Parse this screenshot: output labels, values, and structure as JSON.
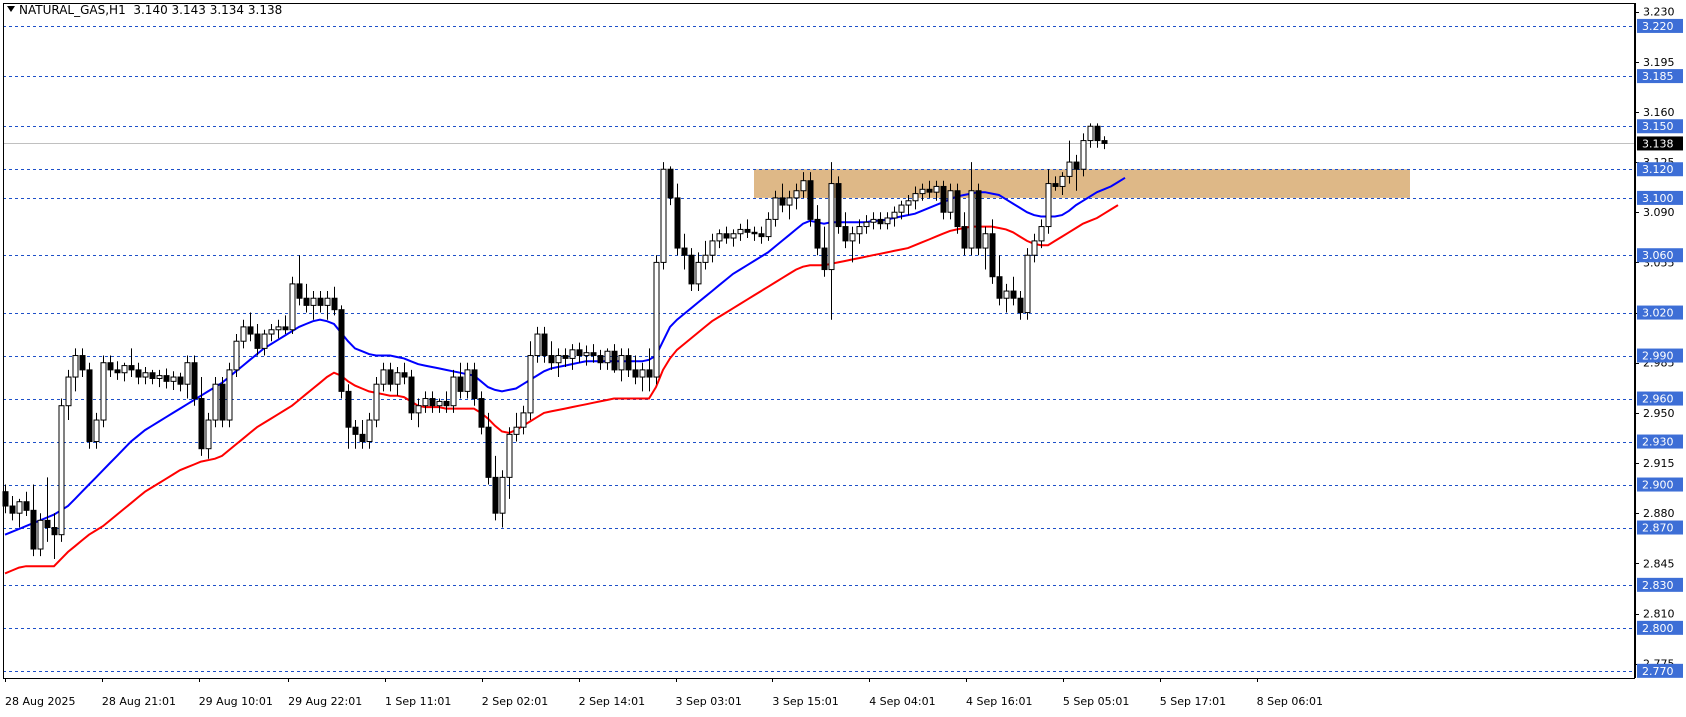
{
  "header": {
    "symbol": "NATURAL_GAS,H1",
    "ohlc": "3.140 3.143 3.134 3.138"
  },
  "chart_data": {
    "type": "candlestick",
    "title": "NATURAL_GAS,H1",
    "ylim": [
      2.765,
      3.236
    ],
    "price_axis_ticks": [
      "3.230",
      "3.195",
      "3.160",
      "3.125",
      "3.090",
      "3.055",
      "3.020",
      "2.985",
      "2.950",
      "2.915",
      "2.880",
      "2.845",
      "2.810",
      "2.775"
    ],
    "time_axis_labels": [
      "28 Aug 2025",
      "28 Aug 21:01",
      "29 Aug 10:01",
      "29 Aug 22:01",
      "1 Sep 11:01",
      "2 Sep 02:01",
      "2 Sep 14:01",
      "3 Sep 03:01",
      "3 Sep 15:01",
      "4 Sep 04:01",
      "4 Sep 16:01",
      "5 Sep 05:01",
      "5 Sep 17:01",
      "8 Sep 06:01"
    ],
    "levels": [
      {
        "label": "3.220",
        "value": 3.22
      },
      {
        "label": "3.185",
        "value": 3.185
      },
      {
        "label": "3.150",
        "value": 3.15
      },
      {
        "label": "3.120",
        "value": 3.12
      },
      {
        "label": "3.100",
        "value": 3.1
      },
      {
        "label": "3.060",
        "value": 3.06
      },
      {
        "label": "3.020",
        "value": 3.02
      },
      {
        "label": "2.990",
        "value": 2.99
      },
      {
        "label": "2.960",
        "value": 2.96
      },
      {
        "label": "2.930",
        "value": 2.93
      },
      {
        "label": "2.900",
        "value": 2.9
      },
      {
        "label": "2.870",
        "value": 2.87
      },
      {
        "label": "2.830",
        "value": 2.83
      },
      {
        "label": "2.800",
        "value": 2.8
      },
      {
        "label": "2.770",
        "value": 2.77
      }
    ],
    "current_price": {
      "label": "3.138",
      "value": 3.138
    },
    "zone": {
      "low": 3.1,
      "high": 3.12,
      "color": "#deb887"
    },
    "candles": [
      [
        2.895,
        2.9,
        2.88,
        2.885
      ],
      [
        2.885,
        2.892,
        2.875,
        2.88
      ],
      [
        2.88,
        2.89,
        2.87,
        2.888
      ],
      [
        2.888,
        2.895,
        2.878,
        2.882
      ],
      [
        2.882,
        2.9,
        2.85,
        2.855
      ],
      [
        2.855,
        2.88,
        2.85,
        2.875
      ],
      [
        2.875,
        2.905,
        2.86,
        2.87
      ],
      [
        2.87,
        2.88,
        2.848,
        2.865
      ],
      [
        2.865,
        2.96,
        2.86,
        2.955
      ],
      [
        2.955,
        2.98,
        2.945,
        2.975
      ],
      [
        2.975,
        2.995,
        2.965,
        2.99
      ],
      [
        2.99,
        2.995,
        2.975,
        2.98
      ],
      [
        2.98,
        2.985,
        2.925,
        2.93
      ],
      [
        2.93,
        2.95,
        2.925,
        2.945
      ],
      [
        2.945,
        2.99,
        2.94,
        2.985
      ],
      [
        2.985,
        2.99,
        2.975,
        2.98
      ],
      [
        2.98,
        2.986,
        2.973,
        2.978
      ],
      [
        2.978,
        2.985,
        2.972,
        2.983
      ],
      [
        2.983,
        2.995,
        2.975,
        2.98
      ],
      [
        2.98,
        2.985,
        2.97,
        2.975
      ],
      [
        2.975,
        2.982,
        2.97,
        2.978
      ],
      [
        2.978,
        2.98,
        2.97,
        2.974
      ],
      [
        2.974,
        2.98,
        2.968,
        2.976
      ],
      [
        2.976,
        2.981,
        2.967,
        2.972
      ],
      [
        2.972,
        2.979,
        2.966,
        2.975
      ],
      [
        2.975,
        2.978,
        2.965,
        2.97
      ],
      [
        2.97,
        2.99,
        2.96,
        2.985
      ],
      [
        2.985,
        2.99,
        2.955,
        2.96
      ],
      [
        2.96,
        2.975,
        2.92,
        2.925
      ],
      [
        2.925,
        2.95,
        2.918,
        2.945
      ],
      [
        2.945,
        2.975,
        2.94,
        2.97
      ],
      [
        2.97,
        2.975,
        2.94,
        2.945
      ],
      [
        2.945,
        2.985,
        2.94,
        2.98
      ],
      [
        2.98,
        3.005,
        2.975,
        3.0
      ],
      [
        3.0,
        3.015,
        2.995,
        3.01
      ],
      [
        3.01,
        3.02,
        3.0,
        3.005
      ],
      [
        3.005,
        3.012,
        2.99,
        2.995
      ],
      [
        2.995,
        3.008,
        2.99,
        3.005
      ],
      [
        3.005,
        3.012,
        3.0,
        3.008
      ],
      [
        3.008,
        3.015,
        3.002,
        3.01
      ],
      [
        3.01,
        3.018,
        3.005,
        3.008
      ],
      [
        3.008,
        3.045,
        3.005,
        3.04
      ],
      [
        3.04,
        3.06,
        3.025,
        3.03
      ],
      [
        3.03,
        3.04,
        3.02,
        3.025
      ],
      [
        3.025,
        3.035,
        3.015,
        3.03
      ],
      [
        3.03,
        3.035,
        3.02,
        3.025
      ],
      [
        3.025,
        3.035,
        3.015,
        3.03
      ],
      [
        3.03,
        3.038,
        3.018,
        3.022
      ],
      [
        3.022,
        3.025,
        2.96,
        2.965
      ],
      [
        2.965,
        2.97,
        2.925,
        2.94
      ],
      [
        2.94,
        2.945,
        2.925,
        2.935
      ],
      [
        2.935,
        2.945,
        2.925,
        2.93
      ],
      [
        2.93,
        2.95,
        2.925,
        2.945
      ],
      [
        2.945,
        2.975,
        2.94,
        2.97
      ],
      [
        2.97,
        2.985,
        2.965,
        2.98
      ],
      [
        2.98,
        2.985,
        2.965,
        2.97
      ],
      [
        2.97,
        2.982,
        2.962,
        2.978
      ],
      [
        2.978,
        2.985,
        2.97,
        2.975
      ],
      [
        2.975,
        2.98,
        2.945,
        2.95
      ],
      [
        2.95,
        2.96,
        2.94,
        2.955
      ],
      [
        2.955,
        2.965,
        2.95,
        2.96
      ],
      [
        2.96,
        2.965,
        2.95,
        2.955
      ],
      [
        2.955,
        2.96,
        2.95,
        2.958
      ],
      [
        2.958,
        2.965,
        2.95,
        2.955
      ],
      [
        2.955,
        2.98,
        2.95,
        2.975
      ],
      [
        2.975,
        2.985,
        2.96,
        2.965
      ],
      [
        2.965,
        2.985,
        2.96,
        2.98
      ],
      [
        2.98,
        2.985,
        2.955,
        2.96
      ],
      [
        2.96,
        2.965,
        2.935,
        2.94
      ],
      [
        2.94,
        2.95,
        2.9,
        2.905
      ],
      [
        2.905,
        2.92,
        2.875,
        2.88
      ],
      [
        2.88,
        2.91,
        2.87,
        2.905
      ],
      [
        2.905,
        2.94,
        2.89,
        2.935
      ],
      [
        2.935,
        2.95,
        2.93,
        2.94
      ],
      [
        2.94,
        2.955,
        2.935,
        2.95
      ],
      [
        2.95,
        3.0,
        2.945,
        2.99
      ],
      [
        2.99,
        3.01,
        2.985,
        3.005
      ],
      [
        3.005,
        3.01,
        2.985,
        2.99
      ],
      [
        2.99,
        3.0,
        2.98,
        2.985
      ],
      [
        2.985,
        2.995,
        2.975,
        2.99
      ],
      [
        2.99,
        2.995,
        2.982,
        2.988
      ],
      [
        2.988,
        2.998,
        2.98,
        2.994
      ],
      [
        2.994,
        2.999,
        2.985,
        2.99
      ],
      [
        2.99,
        2.997,
        2.983,
        2.992
      ],
      [
        2.992,
        2.998,
        2.985,
        2.99
      ],
      [
        2.99,
        2.994,
        2.98,
        2.985
      ],
      [
        2.985,
        2.995,
        2.98,
        2.993
      ],
      [
        2.993,
        2.998,
        2.978,
        2.98
      ],
      [
        2.98,
        2.995,
        2.972,
        2.99
      ],
      [
        2.99,
        2.995,
        2.975,
        2.98
      ],
      [
        2.98,
        2.99,
        2.97,
        2.975
      ],
      [
        2.975,
        2.985,
        2.965,
        2.98
      ],
      [
        2.98,
        2.995,
        2.965,
        2.975
      ],
      [
        2.975,
        3.06,
        2.97,
        3.055
      ],
      [
        3.055,
        3.125,
        3.05,
        3.12
      ],
      [
        3.12,
        3.122,
        3.095,
        3.1
      ],
      [
        3.1,
        3.11,
        3.06,
        3.065
      ],
      [
        3.065,
        3.075,
        3.05,
        3.06
      ],
      [
        3.06,
        3.065,
        3.035,
        3.04
      ],
      [
        3.04,
        3.062,
        3.035,
        3.055
      ],
      [
        3.055,
        3.07,
        3.05,
        3.06
      ],
      [
        3.06,
        3.075,
        3.055,
        3.07
      ],
      [
        3.07,
        3.078,
        3.065,
        3.075
      ],
      [
        3.075,
        3.08,
        3.068,
        3.072
      ],
      [
        3.072,
        3.078,
        3.066,
        3.075
      ],
      [
        3.075,
        3.082,
        3.07,
        3.078
      ],
      [
        3.078,
        3.085,
        3.072,
        3.076
      ],
      [
        3.076,
        3.08,
        3.07,
        3.075
      ],
      [
        3.075,
        3.08,
        3.068,
        3.073
      ],
      [
        3.073,
        3.09,
        3.07,
        3.085
      ],
      [
        3.085,
        3.105,
        3.08,
        3.1
      ],
      [
        3.1,
        3.11,
        3.09,
        3.095
      ],
      [
        3.095,
        3.105,
        3.085,
        3.1
      ],
      [
        3.1,
        3.11,
        3.092,
        3.105
      ],
      [
        3.105,
        3.118,
        3.1,
        3.112
      ],
      [
        3.112,
        3.118,
        3.08,
        3.085
      ],
      [
        3.085,
        3.095,
        3.06,
        3.065
      ],
      [
        3.065,
        3.08,
        3.045,
        3.05
      ],
      [
        3.05,
        3.125,
        3.015,
        3.11
      ],
      [
        3.11,
        3.115,
        3.075,
        3.08
      ],
      [
        3.08,
        3.09,
        3.065,
        3.07
      ],
      [
        3.07,
        3.08,
        3.055,
        3.075
      ],
      [
        3.075,
        3.085,
        3.068,
        3.08
      ],
      [
        3.08,
        3.088,
        3.075,
        3.083
      ],
      [
        3.083,
        3.09,
        3.078,
        3.085
      ],
      [
        3.085,
        3.09,
        3.078,
        3.082
      ],
      [
        3.082,
        3.09,
        3.078,
        3.086
      ],
      [
        3.086,
        3.094,
        3.08,
        3.09
      ],
      [
        3.09,
        3.098,
        3.085,
        3.095
      ],
      [
        3.095,
        3.102,
        3.088,
        3.098
      ],
      [
        3.098,
        3.108,
        3.092,
        3.103
      ],
      [
        3.103,
        3.11,
        3.098,
        3.106
      ],
      [
        3.106,
        3.112,
        3.1,
        3.104
      ],
      [
        3.104,
        3.112,
        3.098,
        3.108
      ],
      [
        3.108,
        3.112,
        3.085,
        3.09
      ],
      [
        3.09,
        3.11,
        3.085,
        3.105
      ],
      [
        3.105,
        3.11,
        3.075,
        3.08
      ],
      [
        3.08,
        3.09,
        3.06,
        3.065
      ],
      [
        3.065,
        3.125,
        3.06,
        3.105
      ],
      [
        3.105,
        3.11,
        3.06,
        3.065
      ],
      [
        3.065,
        3.08,
        3.05,
        3.075
      ],
      [
        3.075,
        3.085,
        3.04,
        3.045
      ],
      [
        3.045,
        3.06,
        3.025,
        3.03
      ],
      [
        3.03,
        3.04,
        3.02,
        3.035
      ],
      [
        3.035,
        3.045,
        3.025,
        3.03
      ],
      [
        3.03,
        3.035,
        3.015,
        3.02
      ],
      [
        3.02,
        3.065,
        3.015,
        3.06
      ],
      [
        3.06,
        3.075,
        3.055,
        3.07
      ],
      [
        3.07,
        3.085,
        3.065,
        3.08
      ],
      [
        3.08,
        3.12,
        3.075,
        3.11
      ],
      [
        3.11,
        3.115,
        3.105,
        3.108
      ],
      [
        3.108,
        3.118,
        3.102,
        3.115
      ],
      [
        3.115,
        3.14,
        3.11,
        3.125
      ],
      [
        3.125,
        3.13,
        3.105,
        3.12
      ],
      [
        3.12,
        3.145,
        3.115,
        3.14
      ],
      [
        3.14,
        3.152,
        3.135,
        3.15
      ],
      [
        3.15,
        3.152,
        3.135,
        3.14
      ],
      [
        3.14,
        3.143,
        3.134,
        3.138
      ]
    ],
    "series": [
      {
        "color": "#0000ff",
        "values": [
          2.865,
          2.867,
          2.869,
          2.871,
          2.873,
          2.875,
          2.877,
          2.879,
          2.882,
          2.885,
          2.89,
          2.895,
          2.9,
          2.905,
          2.91,
          2.915,
          2.92,
          2.925,
          2.93,
          2.934,
          2.938,
          2.941,
          2.944,
          2.947,
          2.95,
          2.953,
          2.956,
          2.959,
          2.962,
          2.965,
          2.968,
          2.971,
          2.975,
          2.979,
          2.983,
          2.987,
          2.991,
          2.995,
          2.998,
          3.001,
          3.004,
          3.007,
          3.01,
          3.012,
          3.014,
          3.015,
          3.014,
          3.012,
          3.006,
          3.0,
          2.995,
          2.993,
          2.991,
          2.99,
          2.99,
          2.99,
          2.989,
          2.988,
          2.986,
          2.984,
          2.983,
          2.982,
          2.981,
          2.98,
          2.979,
          2.978,
          2.977,
          2.976,
          2.972,
          2.968,
          2.966,
          2.965,
          2.966,
          2.967,
          2.97,
          2.973,
          2.976,
          2.979,
          2.981,
          2.982,
          2.983,
          2.984,
          2.985,
          2.986,
          2.986,
          2.986,
          2.986,
          2.986,
          2.986,
          2.986,
          2.986,
          2.986,
          2.987,
          2.99,
          3.0,
          3.01,
          3.015,
          3.019,
          3.023,
          3.027,
          3.031,
          3.035,
          3.039,
          3.043,
          3.047,
          3.05,
          3.053,
          3.056,
          3.059,
          3.062,
          3.066,
          3.07,
          3.074,
          3.078,
          3.082,
          3.084,
          3.083,
          3.082,
          3.083,
          3.083,
          3.083,
          3.083,
          3.083,
          3.083,
          3.084,
          3.084,
          3.085,
          3.086,
          3.087,
          3.088,
          3.089,
          3.091,
          3.093,
          3.095,
          3.097,
          3.099,
          3.101,
          3.102,
          3.103,
          3.104,
          3.104,
          3.103,
          3.102,
          3.099,
          3.096,
          3.093,
          3.09,
          3.088,
          3.087,
          3.087,
          3.087,
          3.088,
          3.091,
          3.095,
          3.098,
          3.101,
          3.104,
          3.106,
          3.108,
          3.111,
          3.114
        ]
      },
      {
        "color": "#ff0000",
        "values": [
          2.838,
          2.84,
          2.842,
          2.843,
          2.843,
          2.843,
          2.843,
          2.843,
          2.848,
          2.853,
          2.857,
          2.861,
          2.865,
          2.868,
          2.871,
          2.875,
          2.879,
          2.883,
          2.887,
          2.891,
          2.895,
          2.898,
          2.901,
          2.904,
          2.907,
          2.91,
          2.912,
          2.914,
          2.916,
          2.917,
          2.918,
          2.92,
          2.924,
          2.928,
          2.932,
          2.936,
          2.94,
          2.943,
          2.946,
          2.949,
          2.952,
          2.955,
          2.959,
          2.963,
          2.967,
          2.971,
          2.975,
          2.978,
          2.976,
          2.972,
          2.969,
          2.967,
          2.965,
          2.964,
          2.963,
          2.962,
          2.962,
          2.961,
          2.958,
          2.955,
          2.954,
          2.954,
          2.954,
          2.953,
          2.953,
          2.953,
          2.953,
          2.953,
          2.95,
          2.946,
          2.941,
          2.937,
          2.936,
          2.938,
          2.941,
          2.944,
          2.947,
          2.95,
          2.951,
          2.952,
          2.953,
          2.954,
          2.955,
          2.956,
          2.957,
          2.958,
          2.959,
          2.96,
          2.96,
          2.96,
          2.96,
          2.96,
          2.96,
          2.968,
          2.98,
          2.988,
          2.994,
          2.998,
          3.002,
          3.006,
          3.01,
          3.014,
          3.017,
          3.02,
          3.023,
          3.026,
          3.029,
          3.032,
          3.035,
          3.038,
          3.041,
          3.044,
          3.047,
          3.05,
          3.052,
          3.053,
          3.053,
          3.053,
          3.054,
          3.055,
          3.056,
          3.057,
          3.058,
          3.059,
          3.06,
          3.061,
          3.062,
          3.063,
          3.064,
          3.065,
          3.067,
          3.069,
          3.071,
          3.073,
          3.075,
          3.077,
          3.078,
          3.079,
          3.08,
          3.08,
          3.08,
          3.08,
          3.079,
          3.078,
          3.076,
          3.073,
          3.07,
          3.068,
          3.067,
          3.067,
          3.07,
          3.073,
          3.076,
          3.079,
          3.082,
          3.084,
          3.086,
          3.089,
          3.092,
          3.095
        ]
      }
    ],
    "grid": false,
    "legend": "none"
  },
  "colors": {
    "background": "#ffffff",
    "level_line": "#1e50c8",
    "level_label_bg": "#3d6ed6",
    "price_line": "#c0c0c0",
    "price_label_bg": "#000000",
    "ma_fast": "#0000ff",
    "ma_slow": "#ff0000"
  }
}
